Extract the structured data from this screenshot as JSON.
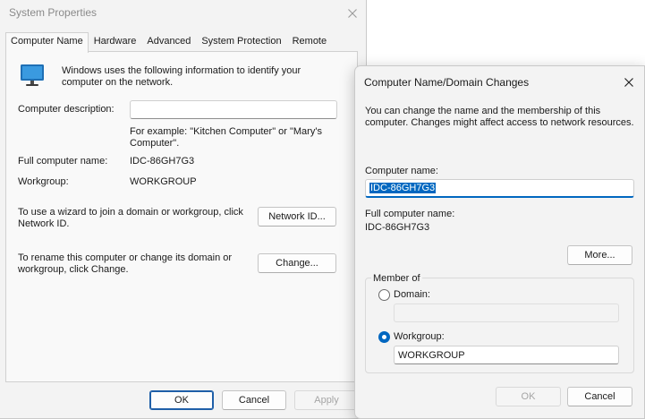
{
  "system_properties": {
    "title": "System Properties",
    "tabs": [
      "Computer Name",
      "Hardware",
      "Advanced",
      "System Protection",
      "Remote"
    ],
    "active_tab": "Computer Name",
    "intro": "Windows uses the following information to identify your computer on the network.",
    "description_label": "Computer description:",
    "description_value": "",
    "example_text": "For example: \"Kitchen Computer\" or \"Mary's Computer\".",
    "full_name_label": "Full computer name:",
    "full_name_value": "IDC-86GH7G3",
    "workgroup_label": "Workgroup:",
    "workgroup_value": "WORKGROUP",
    "wizard_text": "To use a wizard to join a domain or workgroup, click Network ID.",
    "network_id_button": "Network ID...",
    "rename_text": "To rename this computer or change its domain or workgroup, click Change.",
    "change_button": "Change...",
    "ok_button": "OK",
    "cancel_button": "Cancel",
    "apply_button": "Apply",
    "computer_icon": "monitor-icon",
    "close_icon": "close-icon"
  },
  "name_changes": {
    "title": "Computer Name/Domain Changes",
    "intro": "You can change the name and the membership of this computer. Changes might affect access to network resources.",
    "computer_name_label": "Computer name:",
    "computer_name_value": "IDC-86GH7G3",
    "full_name_label": "Full computer name:",
    "full_name_value": "IDC-86GH7G3",
    "more_button": "More...",
    "member_of_label": "Member of",
    "domain_label": "Domain:",
    "domain_value": "",
    "workgroup_label": "Workgroup:",
    "workgroup_value": "WORKGROUP",
    "selected_membership": "Workgroup",
    "ok_button": "OK",
    "cancel_button": "Cancel",
    "close_icon": "close-icon"
  },
  "colors": {
    "accent": "#0067c0",
    "dialog_background": "#f3f3f3",
    "panel_background": "#f9f9f9"
  }
}
